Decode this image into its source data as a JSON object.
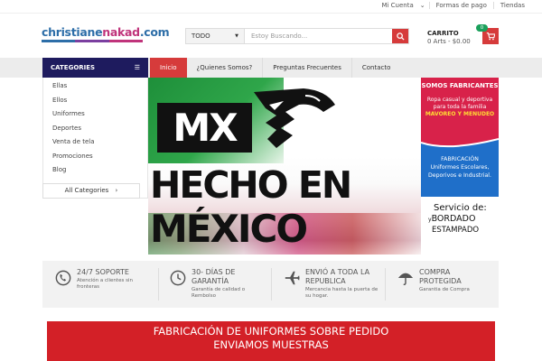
{
  "topbar": {
    "links": [
      "Mi Cuenta",
      "Formas de pago",
      "Tiendas"
    ]
  },
  "header": {
    "logo_part1": "christiane",
    "logo_part2": "nakad",
    "logo_part3": ".com",
    "search": {
      "category": "TODO",
      "placeholder": "Estoy Buscando..."
    },
    "cart": {
      "title": "CARRITO",
      "summary": "0 Arts - $0.00",
      "badge": "0"
    }
  },
  "nav": {
    "categories_label": "CATEGORIES",
    "menu": [
      {
        "label": "Inicio",
        "active": true
      },
      {
        "label": "¿Quienes Somos?",
        "active": false
      },
      {
        "label": "Preguntas Frecuentes",
        "active": false
      },
      {
        "label": "Contacto",
        "active": false
      }
    ]
  },
  "sidebar": {
    "items": [
      "Ellas",
      "Ellos",
      "Uniformes",
      "Deportes",
      "Venta de tela",
      "Promociones",
      "Blog"
    ],
    "all_categories": "All Categories"
  },
  "banner": {
    "mx": "MX",
    "line1": "HECHO EN",
    "line2": "MÉXICO"
  },
  "promo": {
    "heading": "SOMOS FABRICANTES",
    "sub1": "Ropa casual y deportiva para toda la familia",
    "sub2": "MAVOREO Y MENUDEO",
    "mid1": "FABRICACIÓN",
    "mid2": "Uniformes Escolares,",
    "mid3": "Deporivos  e Industrial.",
    "service": "Servicio  de:",
    "bordado": "BORDADO",
    "y": "y",
    "estampado": "ESTAMPADO"
  },
  "features": [
    {
      "icon": "phone-support-icon",
      "title": "24/7 SOPORTE",
      "sub": "Atención a clientes sin fronteras"
    },
    {
      "icon": "clock-icon",
      "title": "30- DÍAS DE GARANTÍA",
      "sub": "Garantía de calidad o Rembolso"
    },
    {
      "icon": "airplane-icon",
      "title": "ENVIÓ A TODA LA REPUBLICA",
      "sub": "Mercancia hasta la puerta de su hogar."
    },
    {
      "icon": "umbrella-icon",
      "title": "COMPRA PROTEGIDA",
      "sub": "Garantia de Compra"
    }
  ],
  "bottom_banner": {
    "line1": "FABRICACIÓN DE UNIFORMES SOBRE PEDIDO",
    "line2": "ENVIAMOS MUESTRAS"
  },
  "colors": {
    "accent_red": "#d63b3b",
    "nav_dark": "#1e1b5e",
    "badge_green": "#1aa05b"
  }
}
